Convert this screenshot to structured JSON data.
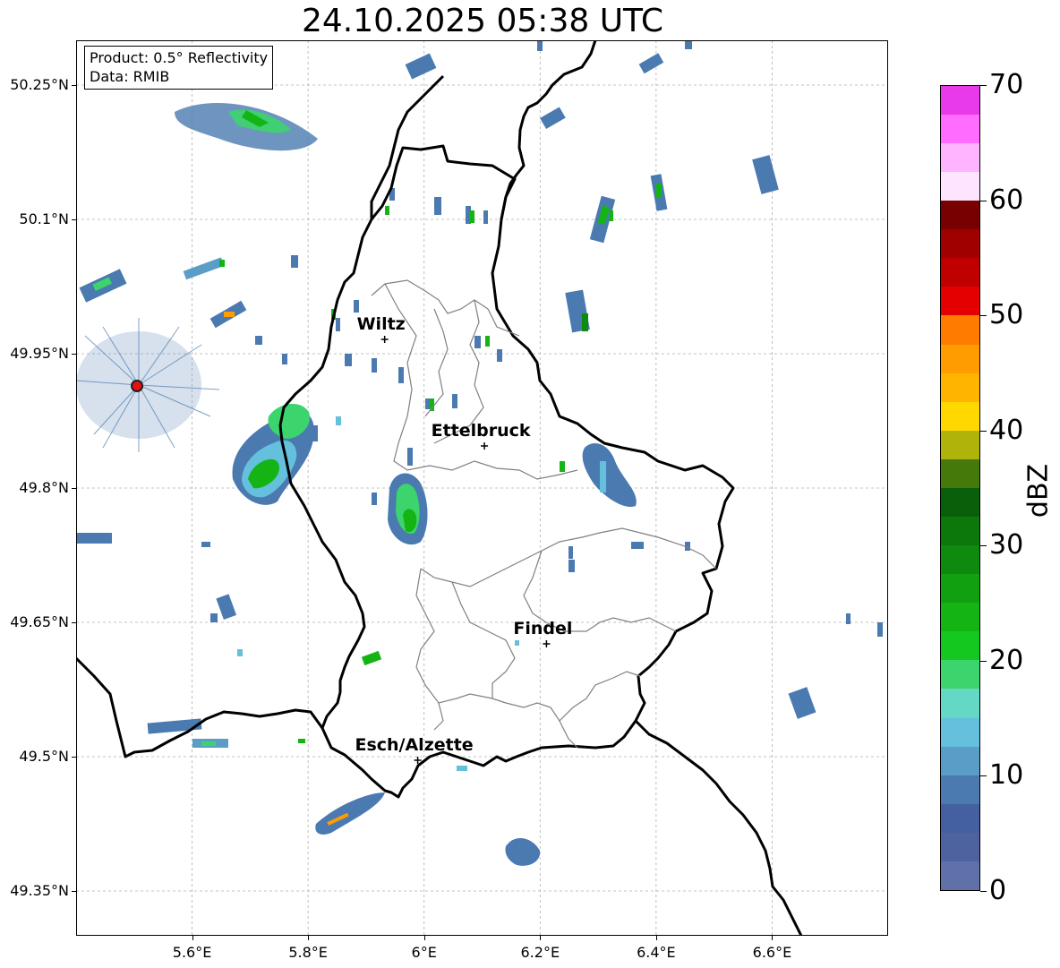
{
  "title": "24.10.2025 05:38 UTC",
  "info": {
    "product": "Product: 0.5° Reflectivity",
    "data_source": "Data: RMIB"
  },
  "map": {
    "lon_range": [
      5.4,
      6.8
    ],
    "lat_range": [
      49.3,
      50.3
    ],
    "lat_ticks": [
      {
        "value": 50.25,
        "label": "50.25°N"
      },
      {
        "value": 50.1,
        "label": "50.1°N"
      },
      {
        "value": 49.95,
        "label": "49.95°N"
      },
      {
        "value": 49.8,
        "label": "49.8°N"
      },
      {
        "value": 49.65,
        "label": "49.65°N"
      },
      {
        "value": 49.5,
        "label": "49.5°N"
      },
      {
        "value": 49.35,
        "label": "49.35°N"
      }
    ],
    "lon_ticks": [
      {
        "value": 5.6,
        "label": "5.6°E"
      },
      {
        "value": 5.8,
        "label": "5.8°E"
      },
      {
        "value": 6.0,
        "label": "6°E"
      },
      {
        "value": 6.2,
        "label": "6.2°E"
      },
      {
        "value": 6.4,
        "label": "6.4°E"
      },
      {
        "value": 6.6,
        "label": "6.6°E"
      }
    ],
    "grid": true,
    "radar_site": {
      "lon": 5.505,
      "lat": 49.914
    },
    "cities": [
      {
        "name": "Wiltz",
        "lon": 5.932,
        "lat": 49.966
      },
      {
        "name": "Ettelbruck",
        "lon": 6.104,
        "lat": 49.847
      },
      {
        "name": "Findel",
        "lon": 6.211,
        "lat": 49.626
      },
      {
        "name": "Esch/Alzette",
        "lon": 5.989,
        "lat": 49.496
      }
    ]
  },
  "colorbar": {
    "label": "dBZ",
    "min": 0,
    "max": 70,
    "ticks": [
      "0",
      "10",
      "20",
      "30",
      "40",
      "50",
      "60",
      "70"
    ],
    "colors": [
      "#6070a8",
      "#4f62a0",
      "#4460a0",
      "#4a7ab0",
      "#5a9ec8",
      "#64c0dc",
      "#64d8c4",
      "#3cd46c",
      "#14c820",
      "#14b414",
      "#10a010",
      "#0e8a0e",
      "#0c780c",
      "#0a600a",
      "#457a0a",
      "#b0b40a",
      "#ffd800",
      "#ffb400",
      "#ff9c00",
      "#ff7c00",
      "#e40000",
      "#c00000",
      "#a00000",
      "#780000",
      "#ffe4ff",
      "#ffb4ff",
      "#ff6cff",
      "#e93ae9"
    ]
  }
}
